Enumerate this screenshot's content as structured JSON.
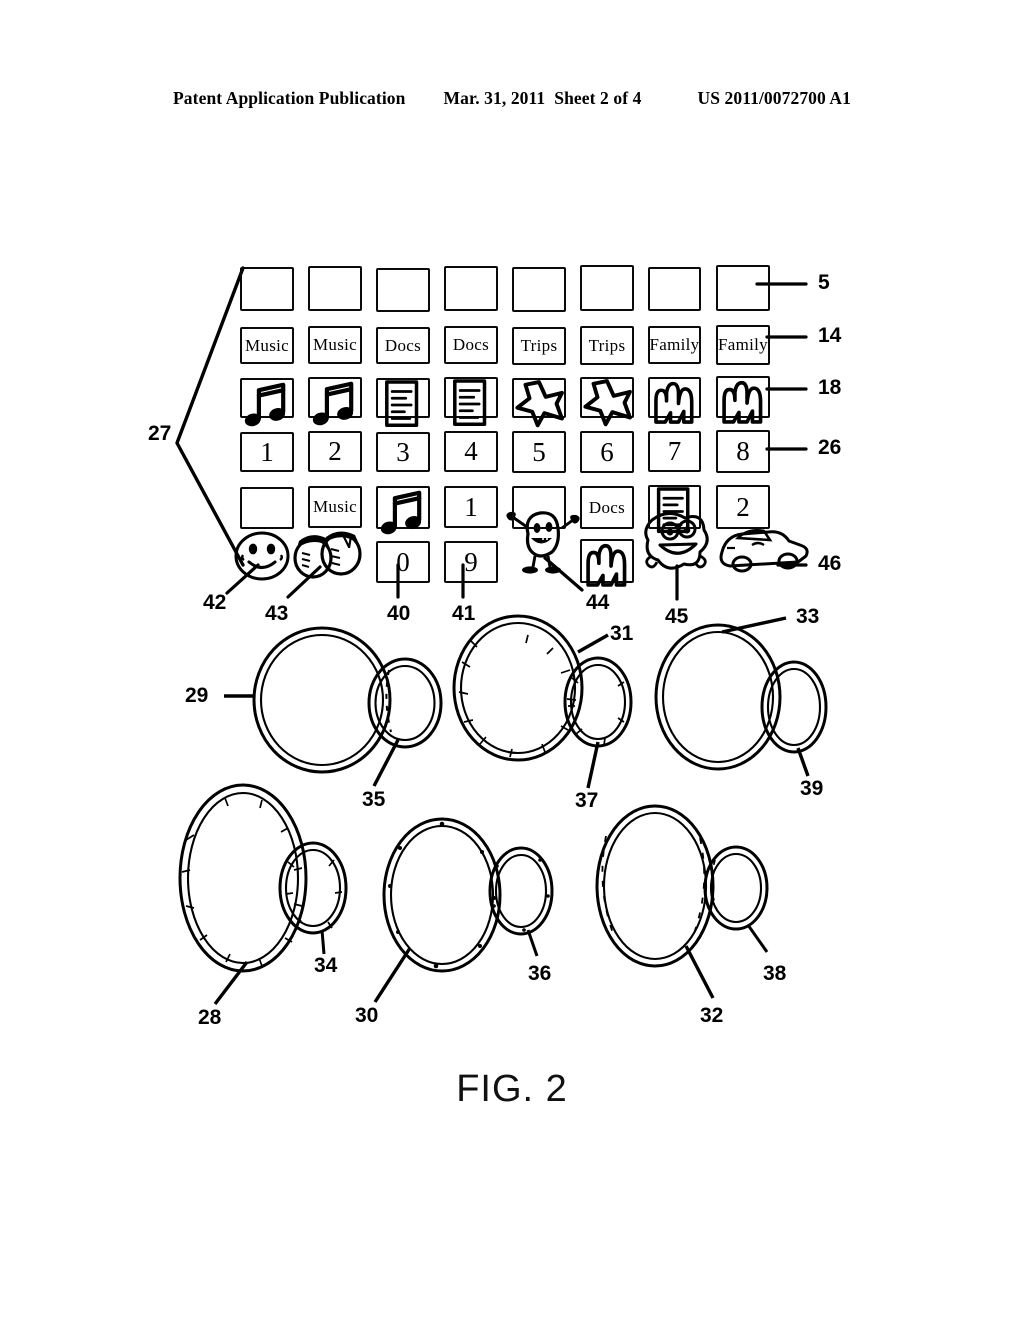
{
  "header": {
    "left": "Patent Application Publication",
    "date": "Mar. 31, 2011",
    "sheet": "Sheet 2 of 4",
    "pubnum": "US 2011/0072700 A1"
  },
  "caption": "FIG. 2",
  "colors": {
    "ink": "#000000",
    "paper": "#ffffff"
  },
  "grid": {
    "columns": 8,
    "rows": [
      {
        "name": "row-blank-top",
        "kind": "box",
        "cells": [
          "",
          "",
          "",
          "",
          "",
          "",
          "",
          ""
        ]
      },
      {
        "name": "row-name-labels",
        "kind": "text",
        "cells": [
          "Music",
          "Music",
          "Docs",
          "Docs",
          "Trips",
          "Trips",
          "Family",
          "Family"
        ]
      },
      {
        "name": "row-icons",
        "kind": "icon",
        "cells": [
          "music-note-icon",
          "music-note-icon",
          "document-icon",
          "document-icon",
          "airplane-icon",
          "airplane-icon",
          "family-icon",
          "family-icon"
        ]
      },
      {
        "name": "row-numbers",
        "kind": "text",
        "cells": [
          "1",
          "2",
          "3",
          "4",
          "5",
          "6",
          "7",
          "8"
        ]
      },
      {
        "name": "row-mixed",
        "kind": "mixed",
        "cells": [
          "",
          "Music",
          "music-note-icon",
          "1",
          "",
          "Docs",
          "document-icon",
          "2"
        ]
      }
    ],
    "bottom_row": {
      "name": "row-sticker",
      "cells": [
        "smiley-face-icon",
        "two-faces-icon",
        "0",
        "9",
        "monster-character-icon",
        "family-icon",
        "frog-character-icon",
        "car-character-icon"
      ]
    }
  },
  "reference_numerals": {
    "bracket": {
      "label": "27"
    },
    "right": [
      {
        "label": "5"
      },
      {
        "label": "14"
      },
      {
        "label": "18"
      },
      {
        "label": "26"
      },
      {
        "label": "46"
      }
    ],
    "bottom_of_grid": [
      {
        "label": "42"
      },
      {
        "label": "43"
      },
      {
        "label": "40"
      },
      {
        "label": "41"
      },
      {
        "label": "44"
      },
      {
        "label": "45"
      }
    ],
    "rings": [
      {
        "label": "29"
      },
      {
        "label": "35"
      },
      {
        "label": "31"
      },
      {
        "label": "37"
      },
      {
        "label": "33"
      },
      {
        "label": "39"
      },
      {
        "label": "28"
      },
      {
        "label": "34"
      },
      {
        "label": "30"
      },
      {
        "label": "36"
      },
      {
        "label": "32"
      },
      {
        "label": "38"
      }
    ]
  },
  "ring_pairs": [
    {
      "name": "ring-pair-29-35",
      "big": "29",
      "small": "35",
      "texture": "smooth"
    },
    {
      "name": "ring-pair-31-37",
      "big": "31",
      "small": "37",
      "texture": "hatched"
    },
    {
      "name": "ring-pair-33-39",
      "big": "33",
      "small": "39",
      "texture": "plain"
    },
    {
      "name": "ring-pair-28-34",
      "big": "28",
      "small": "34",
      "texture": "striped"
    },
    {
      "name": "ring-pair-30-36",
      "big": "30",
      "small": "36",
      "texture": "dotted"
    },
    {
      "name": "ring-pair-32-38",
      "big": "32",
      "small": "38",
      "texture": "dashed"
    }
  ]
}
